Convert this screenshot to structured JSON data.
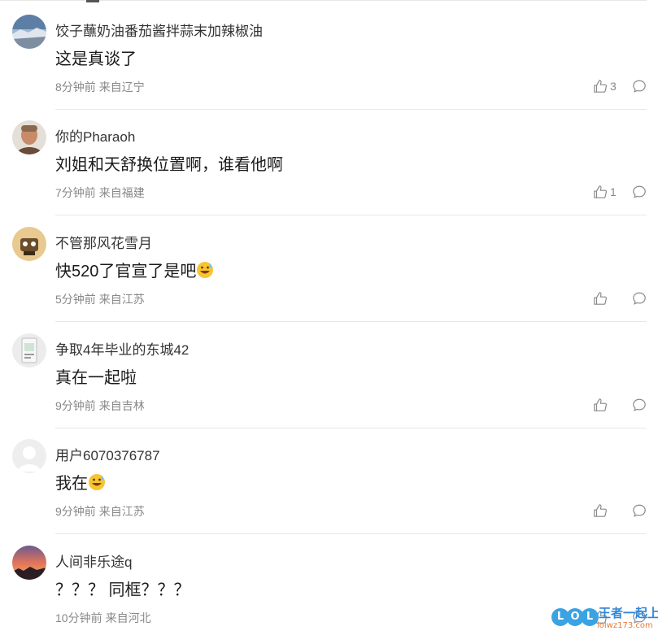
{
  "comments": [
    {
      "username": "饺子蘸奶油番茄酱拌蒜末加辣椒油",
      "text": "这是真谈了",
      "time": "8分钟前",
      "location": "来自辽宁",
      "likes": "3",
      "avatar_icon": "landscape-avatar"
    },
    {
      "username": "你的Pharaoh",
      "text": "刘姐和天舒换位置啊，谁看他啊",
      "time": "7分钟前",
      "location": "来自福建",
      "likes": "1",
      "avatar_icon": "portrait-avatar"
    },
    {
      "username": "不管那风花雪月",
      "text": "快520了官宣了是吧",
      "time": "5分钟前",
      "location": "来自江苏",
      "likes": "",
      "avatar_icon": "cartoon-avatar",
      "emoji": "grinning-sweat-emoji"
    },
    {
      "username": "争取4年毕业的东城42",
      "text": "真在一起啦",
      "time": "9分钟前",
      "location": "来自吉林",
      "likes": "",
      "avatar_icon": "device-avatar"
    },
    {
      "username": "用户6070376787",
      "text": "我在",
      "time": "9分钟前",
      "location": "来自江苏",
      "likes": "",
      "avatar_icon": "default-user-avatar",
      "emoji": "grinning-sweat-emoji"
    },
    {
      "username": "人间非乐途q",
      "text": "？？？ 同框？？？",
      "time": "10分钟前",
      "location": "来自河北",
      "likes": "",
      "avatar_icon": "sunset-avatar"
    }
  ],
  "watermark": {
    "letters": [
      "L",
      "O",
      "L"
    ],
    "title": "王者一起上",
    "url": "lolwz173.com"
  },
  "colors": {
    "meta_text": "#888888",
    "divider": "#e8e8e8",
    "watermark_blue": "#3aa3e3",
    "watermark_orange": "#e37b3a"
  }
}
